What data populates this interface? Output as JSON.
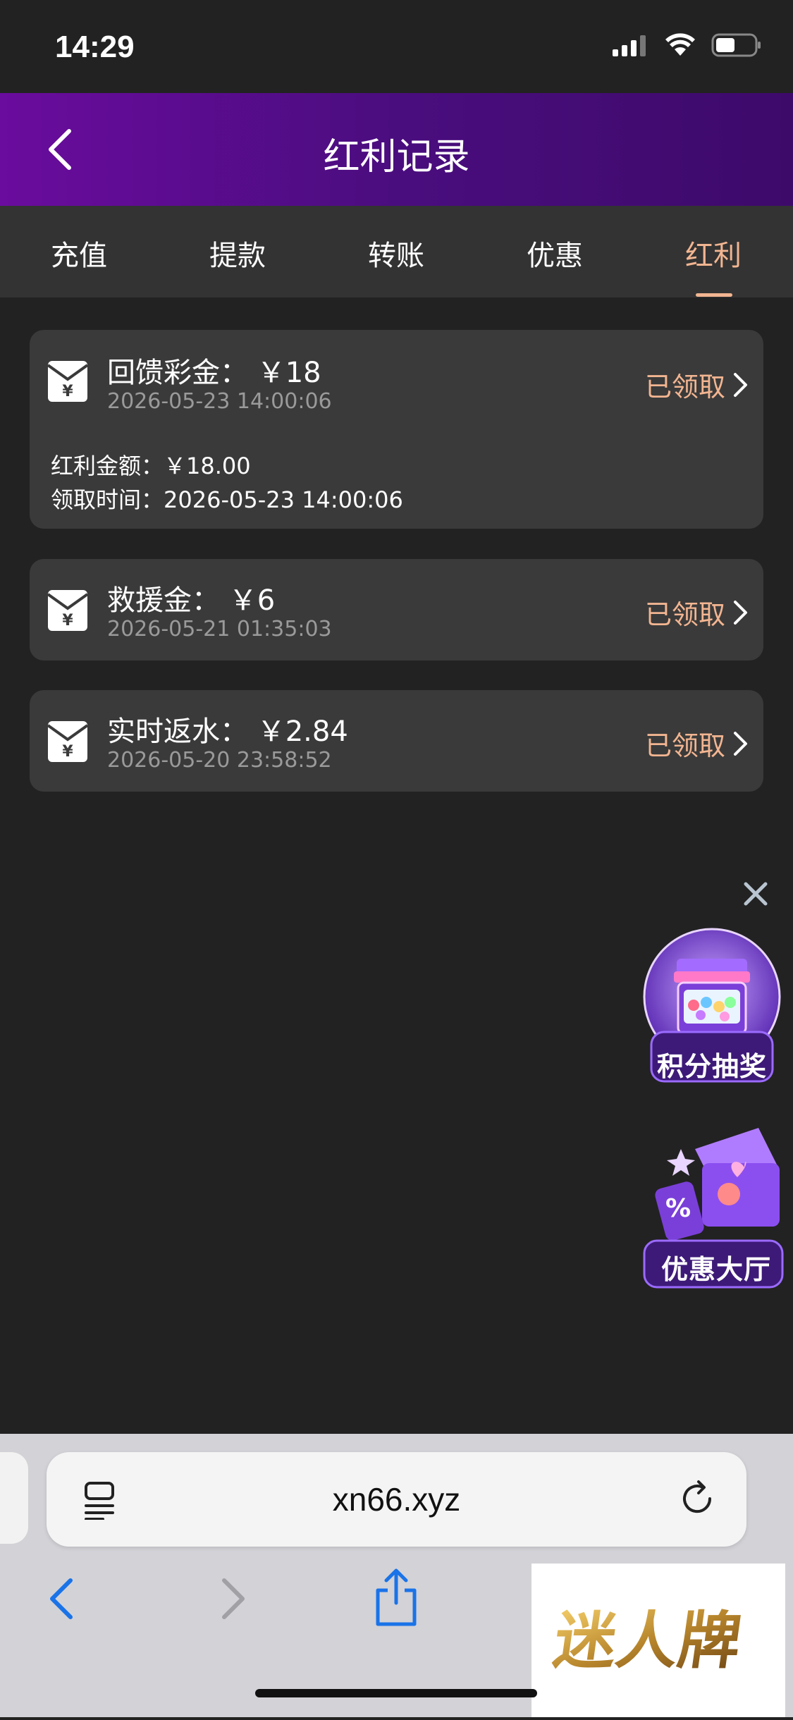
{
  "status_bar": {
    "time": "14:29"
  },
  "header": {
    "title": "红利记录"
  },
  "tabs": [
    {
      "label": "充值"
    },
    {
      "label": "提款"
    },
    {
      "label": "转账"
    },
    {
      "label": "优惠"
    },
    {
      "label": "红利"
    }
  ],
  "active_tab": "红利",
  "records": [
    {
      "title": "回馈彩金： ￥18",
      "date": "2026-05-23 14:00:06",
      "status": "已领取",
      "details": [
        "红利金额：￥18.00",
        "领取时间：2026-05-23 14:00:06"
      ]
    },
    {
      "title": "救援金： ￥6",
      "date": "2026-05-21 01:35:03",
      "status": "已领取"
    },
    {
      "title": "实时返水： ￥2.84",
      "date": "2026-05-20 23:58:52",
      "status": "已领取"
    }
  ],
  "promos": [
    {
      "label": "积分抽奖",
      "icon": "prize-machine-icon"
    },
    {
      "label": "优惠大厅",
      "icon": "gift-box-icon"
    }
  ],
  "browser": {
    "url": "xn66.xyz"
  },
  "watermark": {
    "text": "迷人牌"
  },
  "colors": {
    "accent": "#f2b591",
    "header_start": "#6a0c9e",
    "header_end": "#3d0a6a",
    "card_bg": "#3a3a3a",
    "page_bg": "#222222"
  }
}
